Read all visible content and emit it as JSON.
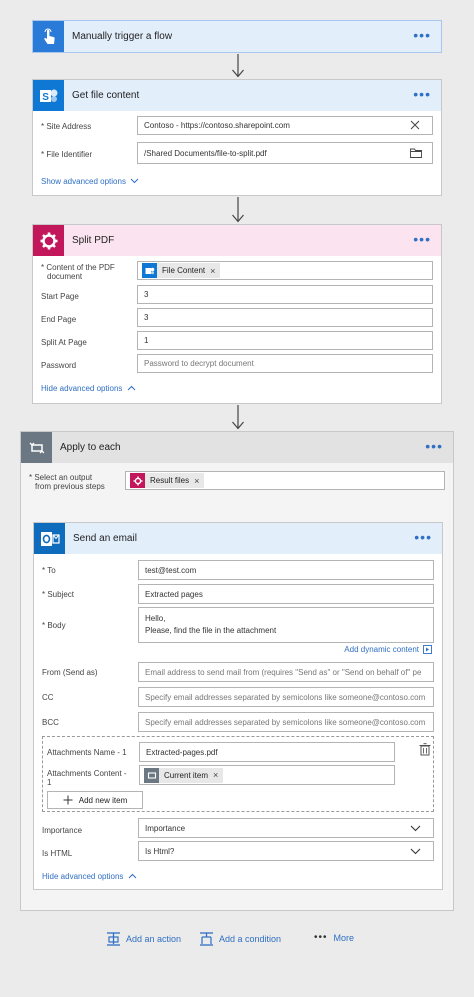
{
  "trigger": {
    "title": "Manually trigger a flow",
    "color": "#2a7bd8"
  },
  "get_file": {
    "title": "Get file content",
    "site_label": "* Site Address",
    "site_value": "Contoso - https://contoso.sharepoint.com",
    "file_label": "* File Identifier",
    "file_value": "/Shared Documents/file-to-split.pdf",
    "advanced": "Show advanced options"
  },
  "split_pdf": {
    "title": "Split PDF",
    "content_label_1": "* Content of the PDF",
    "content_label_2": "document",
    "content_token": "File Content",
    "start_label": "Start Page",
    "start_value": "3",
    "end_label": "End Page",
    "end_value": "3",
    "split_label": "Split At Page",
    "split_value": "1",
    "password_label": "Password",
    "password_placeholder": "Password to decrypt document",
    "advanced": "Hide advanced options"
  },
  "apply_each": {
    "title": "Apply to each",
    "select_label_1": "* Select an output",
    "select_label_2": "from previous steps",
    "select_token": "Result files"
  },
  "email": {
    "title": "Send an email",
    "to_label": "* To",
    "to_value": "test@test.com",
    "subject_label": "* Subject",
    "subject_value": "Extracted pages",
    "body_label": "* Body",
    "body_line1": "Hello,",
    "body_line2": "Please, find the file in the attachment",
    "add_dynamic": "Add dynamic content",
    "from_label": "From (Send as)",
    "from_placeholder": "Email address to send mail from (requires \"Send as\" or \"Send on behalf of\" pe",
    "cc_label": "CC",
    "cc_placeholder": "Specify email addresses separated by semicolons like someone@contoso.com",
    "bcc_label": "BCC",
    "bcc_placeholder": "Specify email addresses separated by semicolons like someone@contoso.com",
    "att_name_label": "Attachments Name - 1",
    "att_name_value": "Extracted-pages.pdf",
    "att_content_label_1": "Attachments Content -",
    "att_content_label_2": "1",
    "att_content_token": "Current item",
    "add_new_item": "Add new item",
    "importance_label": "Importance",
    "importance_value": "Importance",
    "ishtml_label": "Is HTML",
    "ishtml_value": "Is Html?",
    "advanced": "Hide advanced options"
  },
  "footer": {
    "add_action": "Add an action",
    "add_condition": "Add a condition",
    "more": "More"
  },
  "dots": "•••"
}
